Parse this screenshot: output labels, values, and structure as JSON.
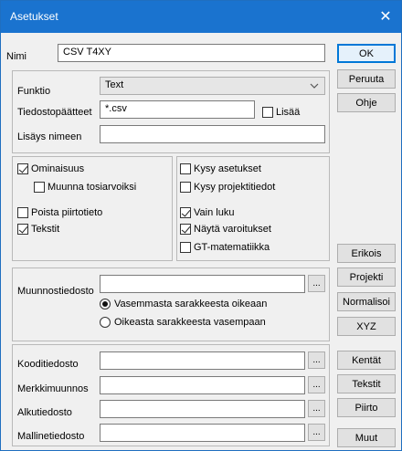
{
  "window": {
    "title": "Asetukset",
    "close_glyph": "✕"
  },
  "fields": {
    "name_label": "Nimi",
    "name_value": "CSV T4XY",
    "function_label": "Funktio",
    "function_value": "Text",
    "extension_label": "Tiedostopäätteet",
    "extension_value": "*.csv",
    "add_label": "Lisää",
    "name_addition_label": "Lisäys nimeen",
    "name_addition_value": ""
  },
  "options_left": {
    "attributes": "Ominaisuus",
    "real_values": "Muunna tosiarvoiksi",
    "remove_drawing": "Poista piirtotieto",
    "texts": "Tekstit"
  },
  "options_right": {
    "ask_settings": "Kysy asetukset",
    "ask_project": "Kysy projektitiedot",
    "read_only": "Vain luku",
    "show_warnings": "Näytä varoitukset",
    "gt_math": "GT-matematiikka"
  },
  "conversion": {
    "file_label": "Muunnostiedosto",
    "left_to_right": "Vasemmasta sarakkeesta oikeaan",
    "right_to_left": "Oikeasta sarakkeesta vasempaan"
  },
  "files": {
    "code_file": "Kooditiedosto",
    "char_conversion": "Merkkimuunnos",
    "init_file": "Alkutiedosto",
    "template_file": "Mallinetiedosto"
  },
  "browse_glyph": "...",
  "buttons": {
    "ok": "OK",
    "cancel": "Peruuta",
    "help": "Ohje",
    "special": "Erikois",
    "project": "Projekti",
    "normalize": "Normalisoi",
    "xyz": "XYZ",
    "fields": "Kentät",
    "texts": "Tekstit",
    "drawing": "Piirto",
    "other": "Muut"
  },
  "icons": {
    "dropdown": "chevron-down-icon",
    "close": "close-icon"
  }
}
